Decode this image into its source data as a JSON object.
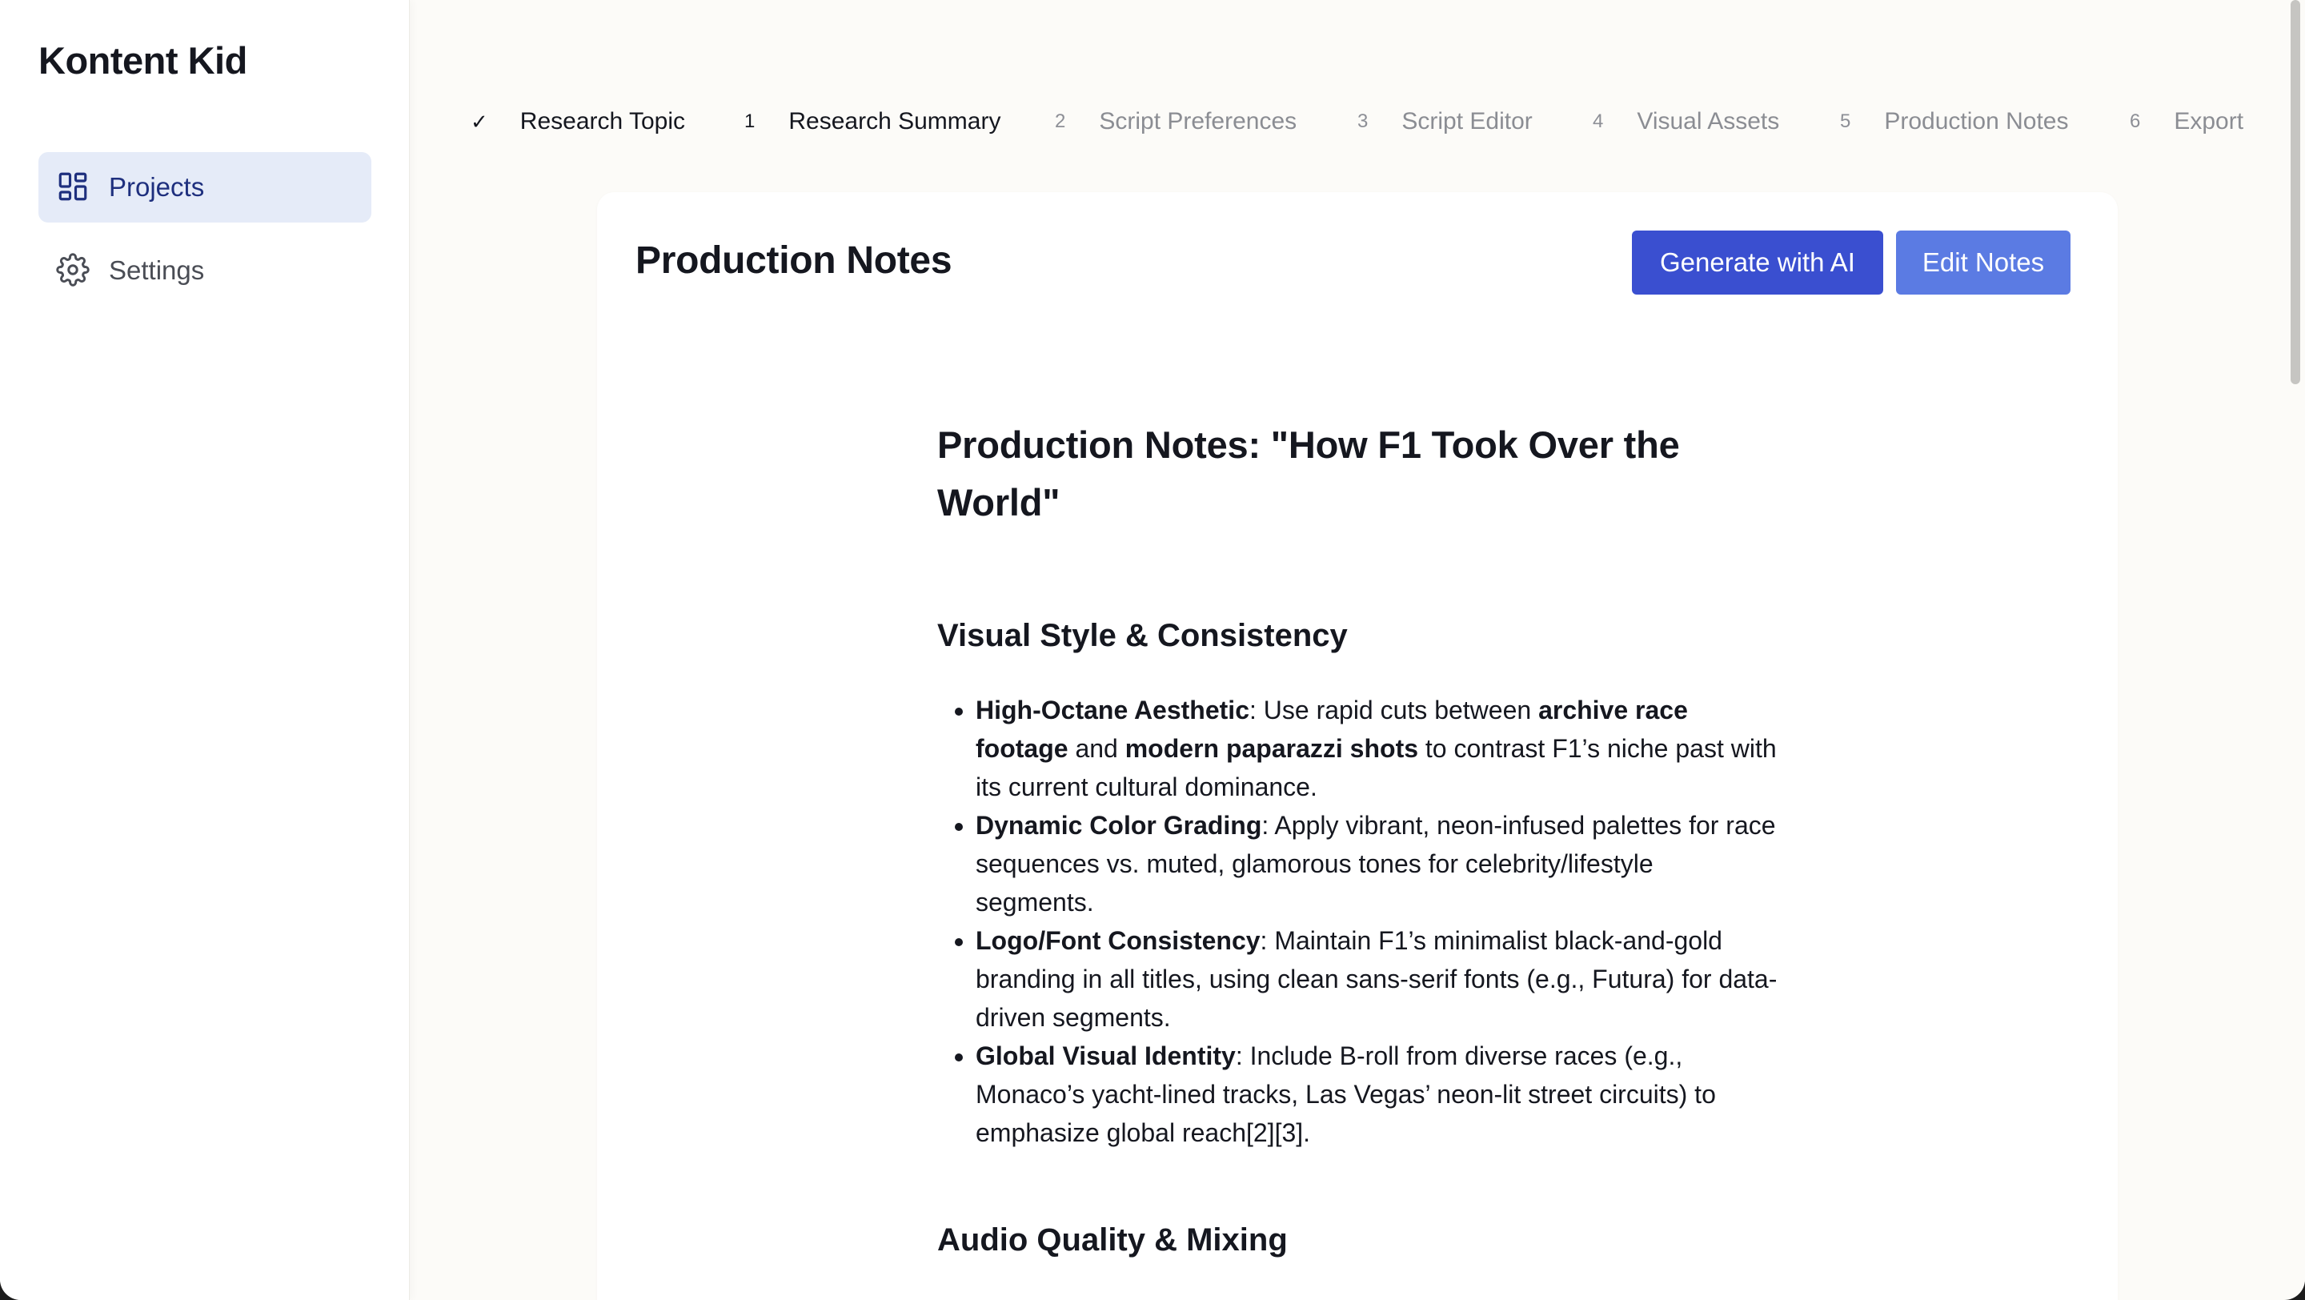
{
  "app": {
    "title": "Kontent Kid"
  },
  "sidebar": {
    "items": [
      {
        "label": "Projects",
        "icon": "grid-icon",
        "active": true
      },
      {
        "label": "Settings",
        "icon": "gear-icon",
        "active": false
      }
    ]
  },
  "stepper": {
    "steps": [
      {
        "marker": "✓",
        "label": "Research Topic",
        "state": "done"
      },
      {
        "marker": "1",
        "label": "Research Summary",
        "state": "current"
      },
      {
        "marker": "2",
        "label": "Script Preferences",
        "state": "upcoming"
      },
      {
        "marker": "3",
        "label": "Script Editor",
        "state": "upcoming"
      },
      {
        "marker": "4",
        "label": "Visual Assets",
        "state": "upcoming"
      },
      {
        "marker": "5",
        "label": "Production Notes",
        "state": "upcoming"
      },
      {
        "marker": "6",
        "label": "Export",
        "state": "upcoming"
      }
    ]
  },
  "panel": {
    "title": "Production Notes",
    "generate_label": "Generate with AI",
    "edit_label": "Edit Notes"
  },
  "document": {
    "heading": "Production Notes: \"How F1 Took Over the World\"",
    "sections": [
      {
        "title": "Visual Style & Consistency",
        "bullets": [
          {
            "term": "High-Octane Aesthetic",
            "text_1": ": Use rapid cuts between ",
            "bold_1": "archive race footage",
            "text_2": " and ",
            "bold_2": "modern paparazzi shots",
            "text_3": " to contrast F1’s niche past with its current cultural dominance."
          },
          {
            "term": "Dynamic Color Grading",
            "text": ": Apply vibrant, neon-infused palettes for race sequences vs. muted, glamorous tones for celebrity/lifestyle segments."
          },
          {
            "term": "Logo/Font Consistency",
            "text": ": Maintain F1’s minimalist black-and-gold branding in all titles, using clean sans-serif fonts (e.g., Futura) for data-driven segments."
          },
          {
            "term": "Global Visual Identity",
            "text": ": Include B-roll from diverse races (e.g., Monaco’s yacht-lined tracks, Las Vegas’ neon-lit street circuits) to emphasize global reach[2][3]."
          }
        ]
      },
      {
        "title": "Audio Quality & Mixing"
      }
    ]
  },
  "colors": {
    "primary_button": "#3a4fd0",
    "secondary_button": "#5b7be3",
    "active_nav_bg": "#e5ebf8",
    "active_nav_text": "#1e2f7e",
    "page_bg": "#fcfbf8"
  }
}
